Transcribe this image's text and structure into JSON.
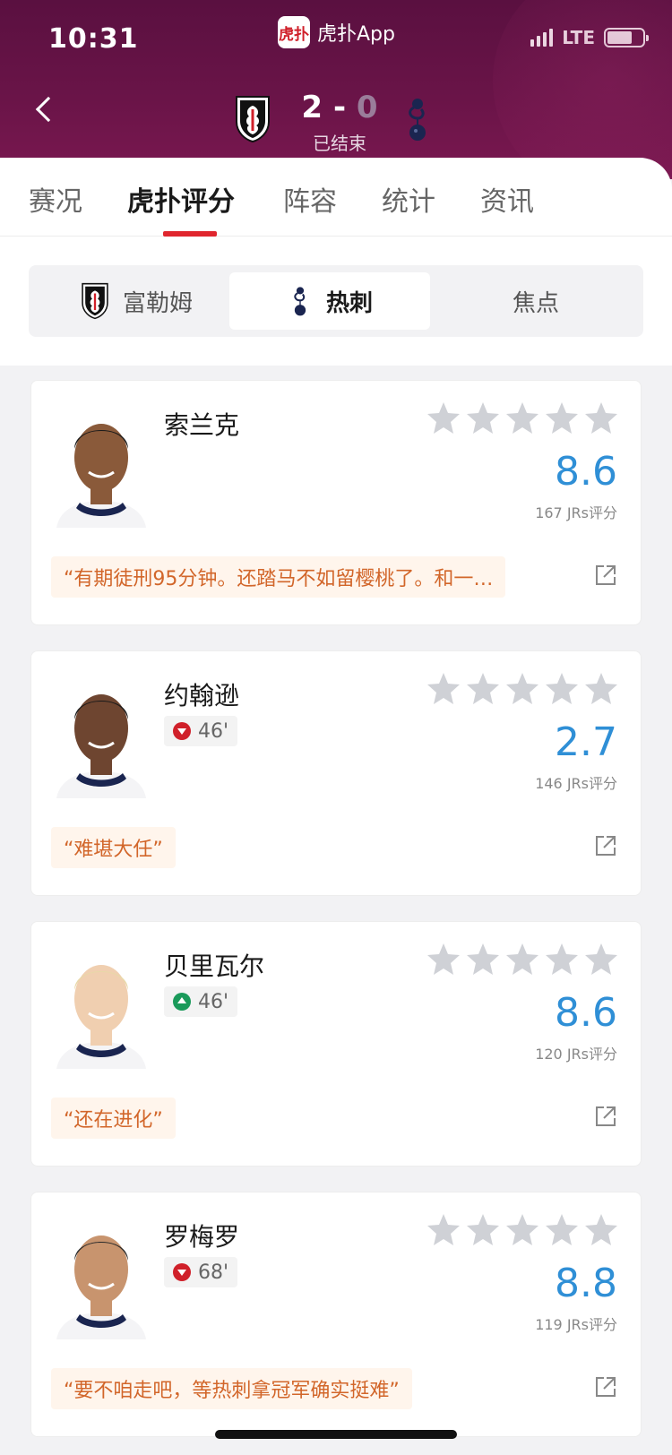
{
  "status_bar": {
    "time": "10:31",
    "network": "LTE"
  },
  "app": {
    "logo_text": "虎扑",
    "title": "虎扑App"
  },
  "match": {
    "home_score": "2",
    "separator": "-",
    "away_score": "0",
    "status": "已结束",
    "home_crest": "fulham-crest",
    "away_crest": "tottenham-crest"
  },
  "tabs": [
    {
      "label": "赛况",
      "active": false
    },
    {
      "label": "虎扑评分",
      "active": true
    },
    {
      "label": "阵容",
      "active": false
    },
    {
      "label": "统计",
      "active": false
    },
    {
      "label": "资讯",
      "active": false
    }
  ],
  "segments": [
    {
      "label": "富勒姆",
      "icon": "fulham-crest",
      "active": false
    },
    {
      "label": "热刺",
      "icon": "tottenham-crest",
      "active": true
    },
    {
      "label": "焦点",
      "active": false
    }
  ],
  "players": [
    {
      "name": "索兰克",
      "rating": "8.6",
      "votes": "167 JRs评分",
      "comment": "“有期徒刑95分钟。还踏马不如留樱桃了。和一…",
      "sub": null
    },
    {
      "name": "约翰逊",
      "rating": "2.7",
      "votes": "146 JRs评分",
      "comment": "“难堪大任”",
      "sub": {
        "type": "out",
        "minute": "46'"
      }
    },
    {
      "name": "贝里瓦尔",
      "rating": "8.6",
      "votes": "120 JRs评分",
      "comment": "“还在进化”",
      "sub": {
        "type": "in",
        "minute": "46'"
      }
    },
    {
      "name": "罗梅罗",
      "rating": "8.8",
      "votes": "119 JRs评分",
      "comment": "“要不咱走吧，等热刺拿冠军确实挺难”",
      "sub": {
        "type": "out",
        "minute": "68'"
      }
    }
  ],
  "colors": {
    "header": "#6a1448",
    "accent": "#e0262e",
    "rating": "#2f8fd6",
    "comment": "#d2662a"
  }
}
